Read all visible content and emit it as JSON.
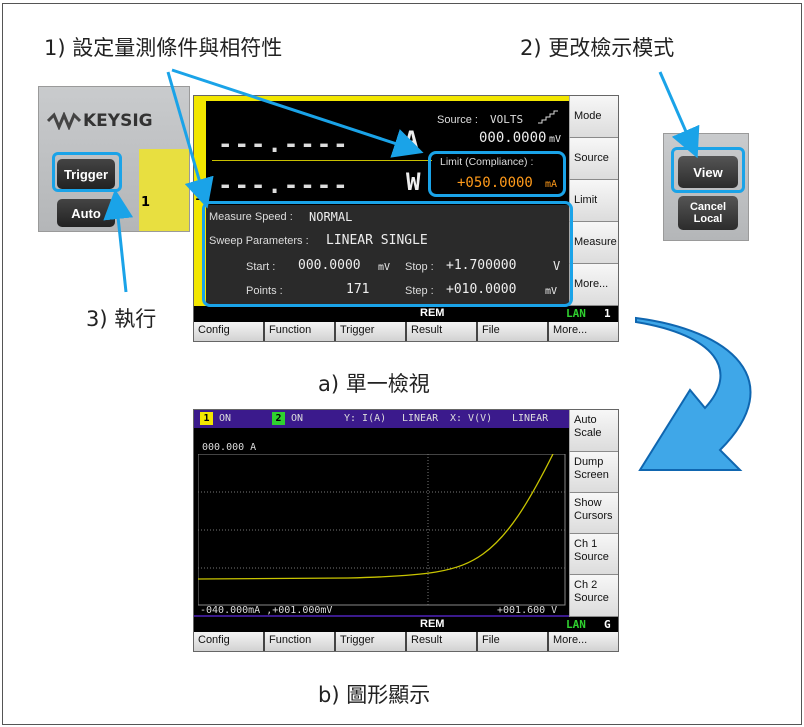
{
  "labels": {
    "step1": "1) 設定量測條件與相符性",
    "step2": "2) 更改檢示模式",
    "step3": "3) 執行",
    "caption_a": "a) 單一檢視",
    "caption_b": "b) 圖形顯示"
  },
  "keypad_left": {
    "brand": "KEYSIG",
    "trigger": "Trigger",
    "auto": "Auto",
    "channel": "1"
  },
  "keypad_right": {
    "view": "View",
    "cancel_local": "Cancel\nLocal"
  },
  "single_view": {
    "channel": "1",
    "source_label": "Source :",
    "source_mode": "VOLTS",
    "current_reading": "---.----",
    "current_unit": "A",
    "power_reading": "---.----",
    "power_unit": "W",
    "source_value": "000.0000",
    "source_unit": "mV",
    "limit_label": "Limit (Compliance) :",
    "limit_value": "+050.0000",
    "limit_unit": "mA",
    "measure_speed_label": "Measure Speed :",
    "measure_speed": "NORMAL",
    "sweep_label": "Sweep Parameters :",
    "sweep_value": "LINEAR SINGLE",
    "start_label": "Start :",
    "start_value": "000.0000",
    "start_unit": "mV",
    "stop_label": "Stop :",
    "stop_value": "+1.700000",
    "stop_unit": "V",
    "points_label": "Points :",
    "points_value": "171",
    "step_label": "Step :",
    "step_value": "+010.0000",
    "step_unit": "mV",
    "status_rem": "REM",
    "status_lan": "LAN",
    "status_ch": "1",
    "softkeys": [
      "Mode",
      "Source",
      "Limit",
      "Measure",
      "More..."
    ],
    "fkeys": [
      "Config",
      "Function",
      "Trigger",
      "Result",
      "File",
      "More..."
    ]
  },
  "graph_view": {
    "ch1_num": "1",
    "ch1_state": "ON",
    "ch2_num": "2",
    "ch2_state": "ON",
    "y_axis": "Y: I(A)",
    "y_scale": "LINEAR",
    "x_axis": "X: V(V)",
    "x_scale": "LINEAR",
    "top_value": "000.000 A",
    "bottom_left": "-040.000mA ,+001.000mV",
    "bottom_right": "+001.600 V",
    "status_rem": "REM",
    "status_lan": "LAN",
    "status_ch": "G",
    "softkeys": [
      "Auto\nScale",
      "Dump\nScreen",
      "Show\nCursors",
      "Ch 1\nSource",
      "Ch 2\nSource"
    ],
    "fkeys": [
      "Config",
      "Function",
      "Trigger",
      "Result",
      "File",
      "More..."
    ]
  },
  "colors": {
    "accent_blue": "#1aa3e8",
    "yellow": "#f2e600",
    "orange": "#ff9a1a",
    "purple_header": "#3b1a8c",
    "trace": "#c8c400",
    "lan_green": "#2fd12f"
  }
}
